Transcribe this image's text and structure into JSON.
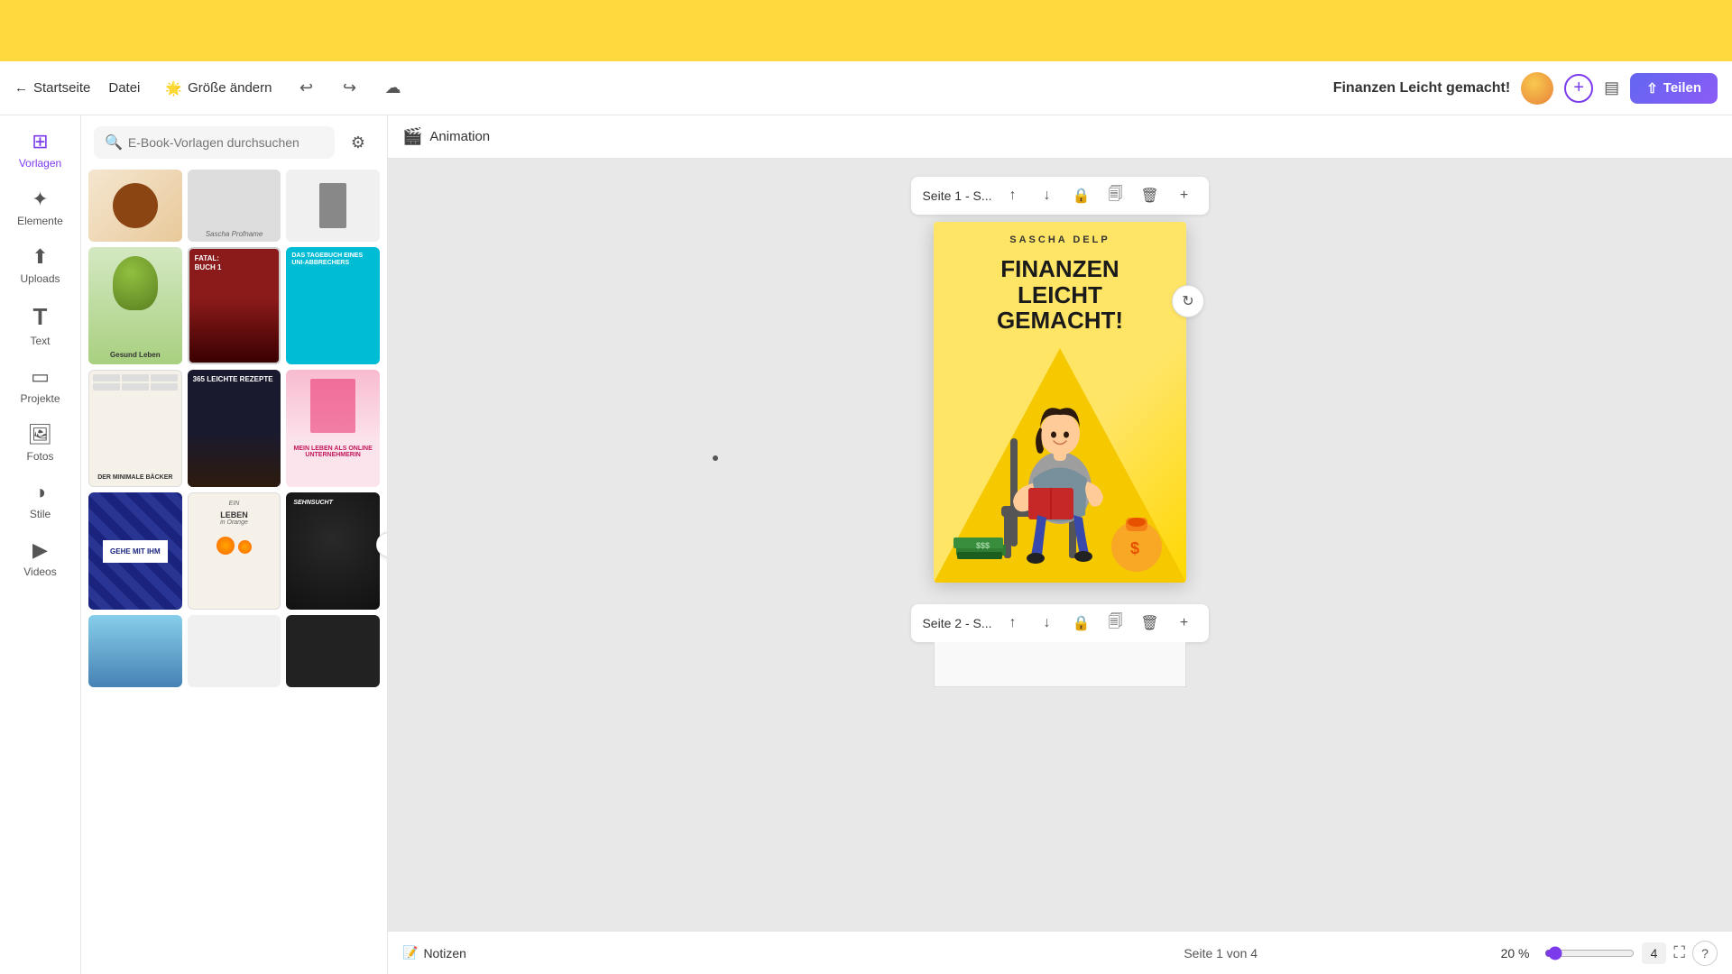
{
  "topBanner": {
    "visible": true
  },
  "header": {
    "back_label": "Startseite",
    "file_label": "Datei",
    "resize_label": "Größe ändern",
    "resize_icon": "🌟",
    "undo_icon": "↩",
    "redo_icon": "↪",
    "cloud_icon": "☁",
    "project_title": "Finanzen Leicht gemacht!",
    "share_label": "Teilen",
    "share_icon": "↑"
  },
  "sidebar": {
    "items": [
      {
        "id": "vorlagen",
        "label": "Vorlagen",
        "icon": "⊞",
        "active": true
      },
      {
        "id": "elemente",
        "label": "Elemente",
        "icon": "✦"
      },
      {
        "id": "uploads",
        "label": "Uploads",
        "icon": "↑"
      },
      {
        "id": "text",
        "label": "Text",
        "icon": "T"
      },
      {
        "id": "projekte",
        "label": "Projekte",
        "icon": "▭"
      },
      {
        "id": "fotos",
        "label": "Fotos",
        "icon": "🖼"
      },
      {
        "id": "stile",
        "label": "Stile",
        "icon": "◑"
      },
      {
        "id": "videos",
        "label": "Videos",
        "icon": "▶"
      }
    ]
  },
  "panel": {
    "search_placeholder": "E-Book-Vorlagen durchsuchen",
    "search_icon": "🔍",
    "filter_icon": "⚙",
    "templates": [
      {
        "id": 1,
        "style": "tc-1",
        "label": ""
      },
      {
        "id": 2,
        "style": "tc-2",
        "label": ""
      },
      {
        "id": 3,
        "style": "tc-3",
        "label": "Sascha Profname"
      },
      {
        "id": 4,
        "style": "tc-4",
        "label": "Gesund Leben"
      },
      {
        "id": 5,
        "style": "tc-5",
        "label": "Fatal: Buch 1"
      },
      {
        "id": 6,
        "style": "tc-6",
        "label": "Das Tagebuch eines Uni-Abbrechers"
      },
      {
        "id": 7,
        "style": "tc-7",
        "label": ""
      },
      {
        "id": 8,
        "style": "tc-8",
        "label": "365 Leichte Rezepte"
      },
      {
        "id": 9,
        "style": "tc-9",
        "label": "Mein Leben als Online-Unternehmerin"
      },
      {
        "id": 10,
        "style": "tc-10",
        "label": ""
      },
      {
        "id": 11,
        "style": "tc-11",
        "label": "Gehe mit ihm"
      },
      {
        "id": 12,
        "style": "tc-12",
        "label": "Sehnsucht"
      },
      {
        "id": 13,
        "style": "tc-13",
        "label": "Ein Leben in Orange"
      },
      {
        "id": 14,
        "style": "tc-14",
        "label": ""
      },
      {
        "id": 15,
        "style": "tc-15",
        "label": ""
      },
      {
        "id": 16,
        "style": "tc-2",
        "label": ""
      },
      {
        "id": 17,
        "style": "tc-1",
        "label": ""
      },
      {
        "id": 18,
        "style": "tc-5",
        "label": "Der minimale Bäcker"
      }
    ]
  },
  "animation": {
    "label": "Animation",
    "icon": "🎬"
  },
  "canvas": {
    "page1": {
      "label": "Seite 1 - S...",
      "cover": {
        "author": "SASCHA DELP",
        "title": "FINANZEN LEICHT GEMACHT!"
      }
    },
    "page2": {
      "label": "Seite 2 - S..."
    }
  },
  "statusBar": {
    "notes_icon": "📝",
    "notes_label": "Notizen",
    "page_info": "Seite 1 von 4",
    "zoom_percent": "20 %",
    "zoom_value": 20,
    "pages_count": "4",
    "fullscreen_icon": "⛶",
    "help_icon": "?"
  }
}
